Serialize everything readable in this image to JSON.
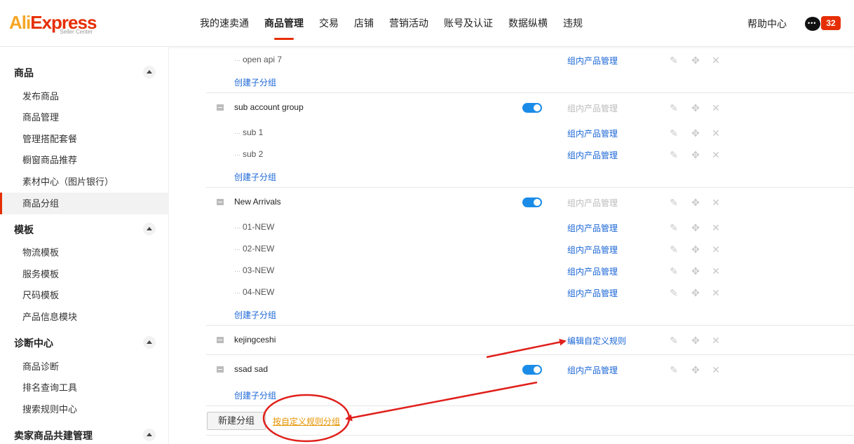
{
  "header": {
    "logo_main": "AliExpress",
    "logo_sub": "Seller Center",
    "nav": [
      "我的速卖通",
      "商品管理",
      "交易",
      "店铺",
      "营销活动",
      "账号及认证",
      "数据纵横",
      "违规"
    ],
    "help": "帮助中心",
    "chat_icon": "chat-icon",
    "badge": "32"
  },
  "sidebar": {
    "sections": [
      {
        "title": "商品",
        "items": [
          "发布商品",
          "商品管理",
          "管理搭配套餐",
          "橱窗商品推荐",
          "素材中心（图片银行）",
          "商品分组"
        ]
      },
      {
        "title": "模板",
        "items": [
          "物流模板",
          "服务模板",
          "尺码模板",
          "产品信息模块"
        ]
      },
      {
        "title": "诊断中心",
        "items": [
          "商品诊断",
          "排名查询工具",
          "搜索规则中心"
        ]
      },
      {
        "title": "卖家商品共建管理",
        "items": []
      }
    ],
    "active_item": "商品分组"
  },
  "groups": {
    "top_sub": {
      "name": "open api 7",
      "manage": "组内产品管理"
    },
    "create_label": "创建子分组",
    "manage_label": "组内产品管理",
    "g1": {
      "name": "sub account group",
      "subs": [
        "sub 1",
        "sub 2"
      ]
    },
    "g2": {
      "name": "New Arrivals",
      "subs": [
        "01-NEW",
        "02-NEW",
        "03-NEW",
        "04-NEW"
      ]
    },
    "g3": {
      "name": "kejingceshi",
      "rule": "编辑自定义规则"
    },
    "g4": {
      "name": "ssad sad"
    }
  },
  "footer": {
    "new_group": "新建分组",
    "custom_rule_group": "按自定义规则分组"
  },
  "colors": {
    "accent": "#e62e04",
    "link": "#1a66d6",
    "annotation": "#e0201c",
    "toggle_on": "#1a8ce8"
  }
}
